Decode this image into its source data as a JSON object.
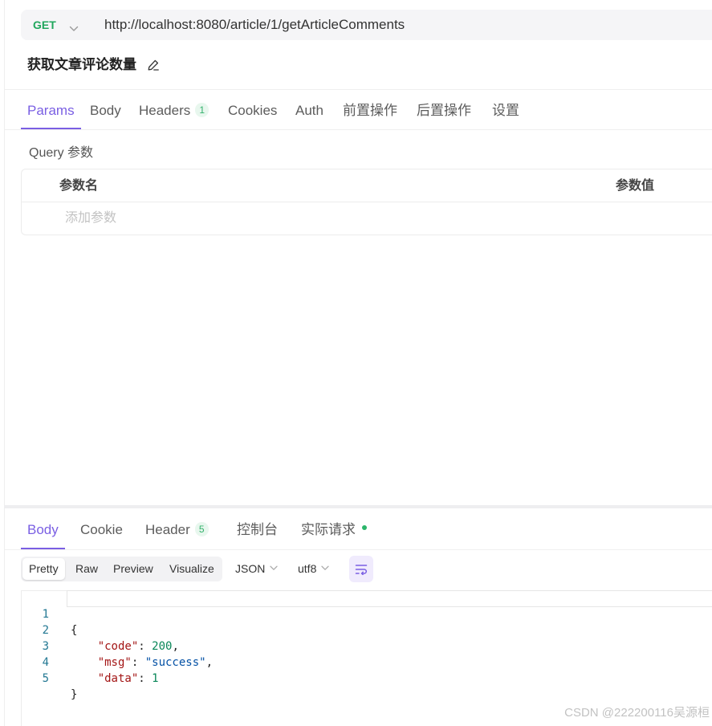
{
  "request": {
    "method": "GET",
    "url": "http://localhost:8080/article/1/getArticleComments",
    "title": "获取文章评论数量",
    "tabs": [
      {
        "label": "Params",
        "active": true
      },
      {
        "label": "Body",
        "active": false
      },
      {
        "label": "Headers",
        "badge": "1",
        "active": false
      },
      {
        "label": "Cookies",
        "active": false
      },
      {
        "label": "Auth",
        "active": false
      },
      {
        "label": "前置操作",
        "active": false
      },
      {
        "label": "后置操作",
        "active": false
      },
      {
        "label": "设置",
        "active": false
      }
    ],
    "query": {
      "heading": "Query 参数",
      "column_name": "参数名",
      "column_value": "参数值",
      "add_placeholder": "添加参数"
    }
  },
  "response": {
    "tabs": [
      {
        "label": "Body",
        "active": true
      },
      {
        "label": "Cookie",
        "active": false
      },
      {
        "label": "Header",
        "badge": "5",
        "active": false
      },
      {
        "label": "控制台",
        "active": false
      },
      {
        "label": "实际请求",
        "status_dot": true,
        "active": false
      }
    ],
    "view_modes": [
      {
        "label": "Pretty",
        "active": true
      },
      {
        "label": "Raw",
        "active": false
      },
      {
        "label": "Preview",
        "active": false
      },
      {
        "label": "Visualize",
        "active": false
      }
    ],
    "format": "JSON",
    "encoding": "utf8",
    "wrap_lines": true,
    "body": {
      "lines": [
        {
          "number": "1",
          "open": "{"
        },
        {
          "number": "2",
          "key": "\"code\"",
          "colon": ":",
          "value": "200",
          "comma": ","
        },
        {
          "number": "3",
          "key": "\"msg\"",
          "colon": ":",
          "value": "\"success\"",
          "comma": ","
        },
        {
          "number": "4",
          "key": "\"data\"",
          "colon": ":",
          "value": "1"
        },
        {
          "number": "5",
          "close": "}"
        }
      ]
    }
  },
  "watermark": "CSDN @222200116吴源桓",
  "colors": {
    "accent": "#7a5fe3",
    "method_get": "#20a65c",
    "badge_bg": "#e8f7ee",
    "badge_text": "#33b06b",
    "status_dot": "#2bb56a",
    "json_key": "#a31515",
    "json_number": "#098658",
    "json_string": "#0451a5",
    "line_number": "#237893",
    "wrap_bg": "#f0ebfd"
  },
  "icons": {
    "method_dropdown": "chevron-down-icon",
    "edit_title": "pencil-icon",
    "format_dropdown": "chevron-down-icon",
    "encoding_dropdown": "chevron-down-icon",
    "wrap_toggle": "wrap-lines-icon"
  }
}
